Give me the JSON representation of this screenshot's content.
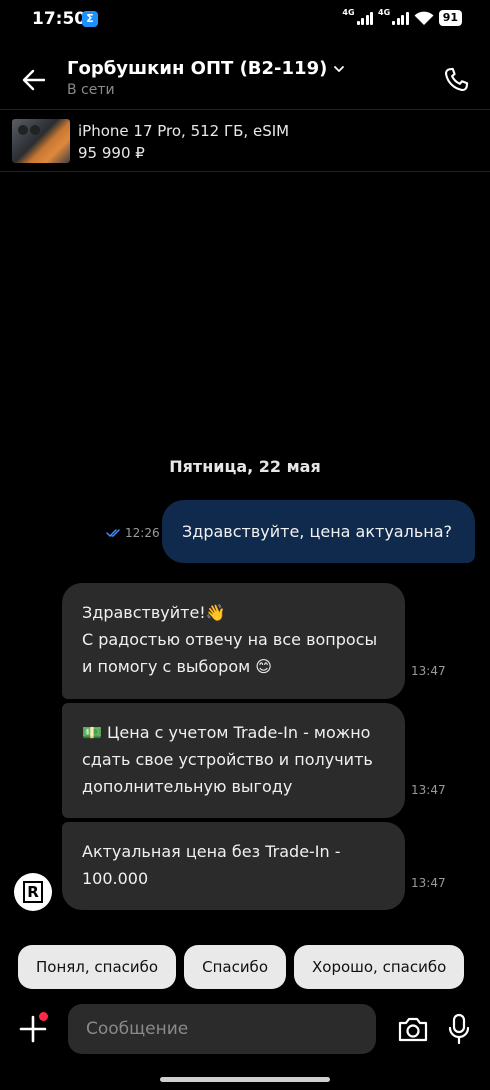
{
  "status_bar": {
    "time": "17:50",
    "app_icon": "Σ",
    "network_1": "4G",
    "network_2": "4G",
    "battery": "91"
  },
  "header": {
    "title": "Горбушкин ОПТ (B2-119)",
    "subtitle": "В сети",
    "icons": {
      "back": "arrow-left",
      "expand": "chevron-down",
      "call": "phone"
    }
  },
  "product": {
    "name": "iPhone 17 Pro, 512 ГБ, eSIM",
    "price": "95 990 ₽"
  },
  "chat": {
    "date_separator": "Пятница, 22 мая",
    "outgoing": [
      {
        "text": "Здравствуйте, цена актуальна?",
        "time": "12:26",
        "status": "read"
      }
    ],
    "incoming": [
      {
        "lines": [
          "Здравствуйте!👋",
          "С радостью отвечу на все вопросы",
          "и помогу с выбором 😊"
        ],
        "time": "13:47"
      },
      {
        "lines": [
          "💵 Цена с учетом Trade-In - можно",
          "сдать свое устройство и получить",
          "дополнительную выгоду"
        ],
        "time": "13:47"
      },
      {
        "lines": [
          "Актуальная цена без Trade-In -",
          "100.000"
        ],
        "time": "13:47"
      }
    ],
    "avatar_letter": "R"
  },
  "quick_replies": [
    "Понял, спасибо",
    "Спасибо",
    "Хорошо, спасибо"
  ],
  "composer": {
    "placeholder": "Сообщение",
    "icons": {
      "attach": "plus",
      "camera": "camera",
      "voice": "microphone"
    }
  },
  "colors": {
    "background": "#000000",
    "outgoing_bubble": "#0f2a4d",
    "incoming_bubble": "#2b2b2b",
    "read_check": "#3d8bff",
    "notification_dot": "#ff2a4a"
  }
}
